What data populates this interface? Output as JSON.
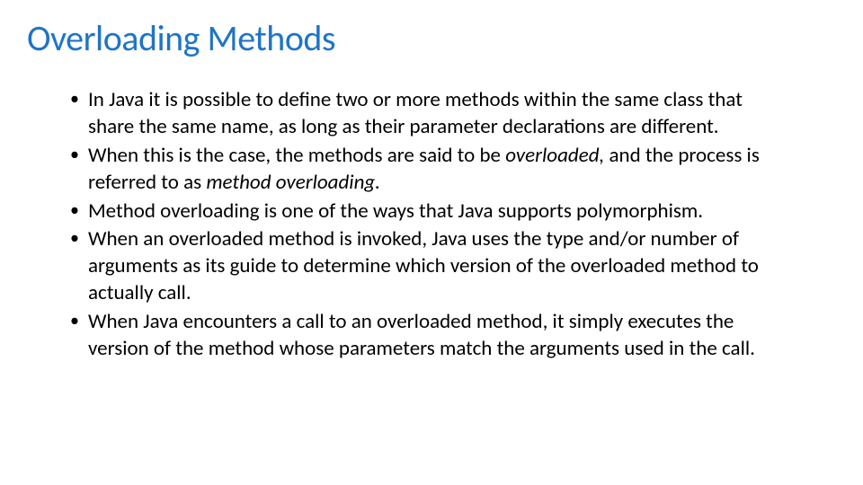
{
  "slide": {
    "title": "Overloading Methods",
    "bullets": {
      "b0": "In Java it is possible to define two or more methods within the same class that share the same name, as long as their parameter declarations are different.",
      "b1_pre": "When this is the case, the methods are said to be ",
      "b1_italic1": "overloaded, ",
      "b1_mid": "and the process is referred to as ",
      "b1_italic2": "method overloading.",
      "b2": "Method overloading is one of the ways that Java supports polymorphism.",
      "b3": "When an overloaded method is invoked, Java uses the type and/or number of arguments as its guide to determine which version of the overloaded method to actually call.",
      "b4": "When Java encounters a call to an overloaded method, it simply executes the version of the method whose parameters match the arguments used in the call."
    }
  }
}
